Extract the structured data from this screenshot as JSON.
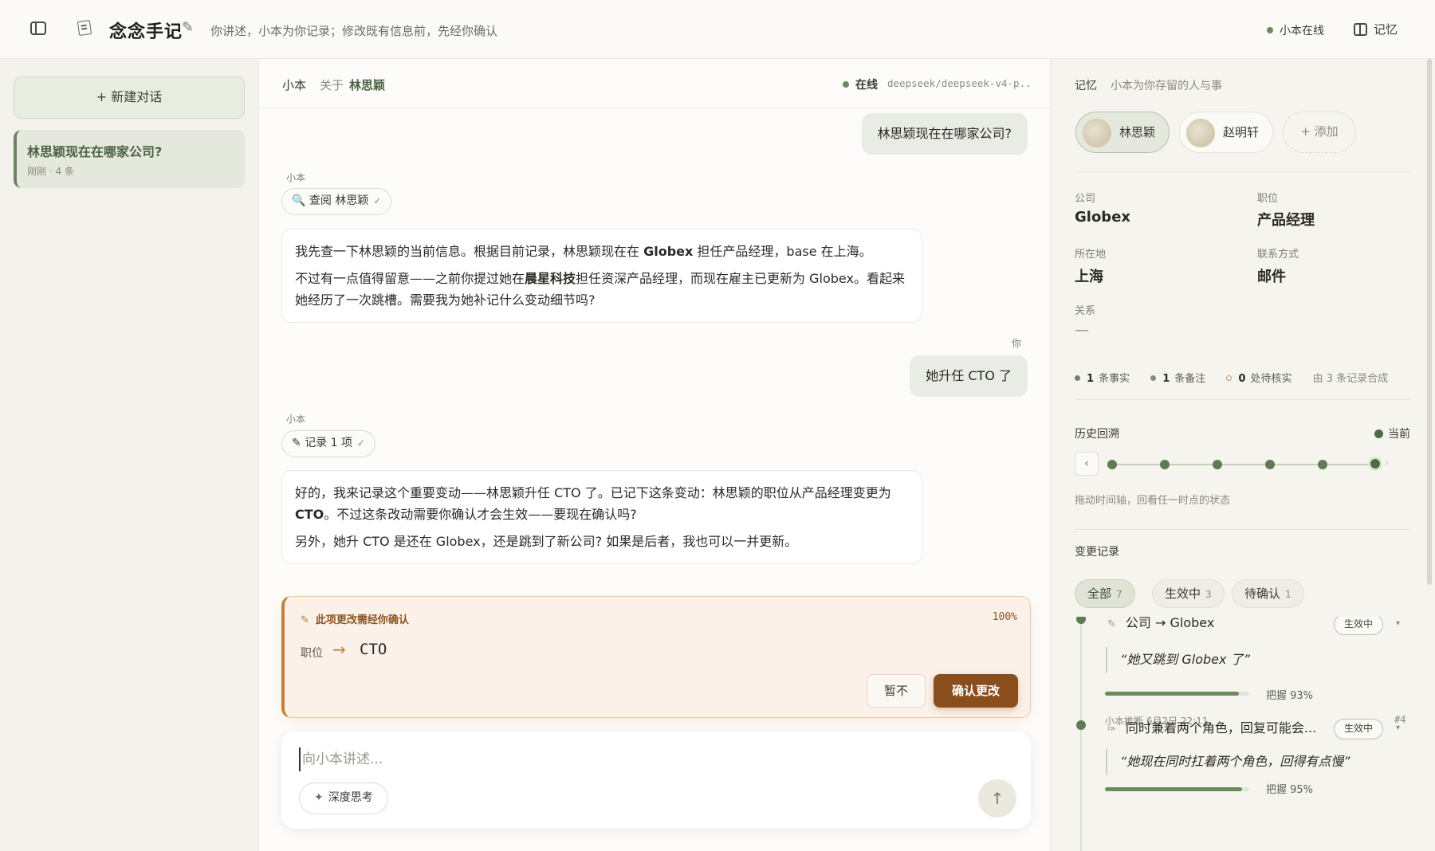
{
  "header": {
    "app_title": "念念手记",
    "title_pen": "✎",
    "subtitle": "你讲述，小本为你记录；修改既有信息前，先经你确认",
    "status": "小本在线",
    "memory_button": "记忆"
  },
  "sidebar": {
    "new_chat": "+ 新建对话",
    "conversations": [
      {
        "title": "林思颖现在在哪家公司?",
        "meta": "刚刚 · 4 条"
      }
    ]
  },
  "chat": {
    "header": {
      "name": "小本",
      "about": "关于",
      "person": "林思颖",
      "status": "在线",
      "model": "deepseek/deepseek-v4-p..."
    },
    "messages": {
      "user1": "林思颖现在在哪家公司?",
      "ai1_speaker": "小本",
      "ai1_tool": "查阅 林思颖",
      "ai1_p1_a": "我先查一下林思颖的当前信息。根据目前记录，林思颖现在在 ",
      "ai1_p1_b": "Globex",
      "ai1_p1_c": " 担任产品经理，base 在上海。",
      "ai1_p2_a": "不过有一点值得留意——之前你提过她在",
      "ai1_p2_b": "晨星科技",
      "ai1_p2_c": "担任资深产品经理，而现在雇主已更新为 Globex。看起来她经历了一次跳槽。需要我为她补记什么变动细节吗?",
      "user2_speaker": "你",
      "user2": "她升任 CTO 了",
      "ai2_speaker": "小本",
      "ai2_tool": "记录 1 项",
      "ai2_p1_a": "好的，我来记录这个重要变动——林思颖升任 CTO 了。已记下这条变动：林思颖的职位从产品经理变更为 ",
      "ai2_p1_b": "CTO",
      "ai2_p1_c": "。不过这条改动需要你确认才会生效——要现在确认吗?",
      "ai2_p2": "另外，她升 CTO 是还在 Globex，还是跳到了新公司? 如果是后者，我也可以一并更新。"
    },
    "confirm": {
      "title": "此项更改需经你确认",
      "percent": "100%",
      "field": "职位",
      "arrow": "→",
      "value": "CTO",
      "later": "暂不",
      "ok": "确认更改"
    },
    "composer": {
      "placeholder": "向小本讲述...",
      "think": "深度思考",
      "send": "↑"
    }
  },
  "memory": {
    "title": "记忆",
    "subtitle": "小本为你存留的人与事",
    "people": [
      "林思颖",
      "赵明轩"
    ],
    "add": "+ 添加",
    "fields": {
      "company_label": "公司",
      "company": "Globex",
      "title_label": "职位",
      "title": "产品经理",
      "location_label": "所在地",
      "location": "上海",
      "contact_label": "联系方式",
      "contact": "邮件",
      "relation_label": "关系",
      "relation": "—"
    },
    "stats": {
      "facts_n": "1",
      "facts": "条事实",
      "notes_n": "1",
      "notes": "条备注",
      "pending_n": "0",
      "pending": "处待核实",
      "synth": "由 3 条记录合成"
    },
    "history": {
      "title": "历史回溯",
      "current": "当前",
      "prev": "‹",
      "next": "›",
      "hint": "拖动时间轴，回看任一时点的状态"
    },
    "changes": {
      "title": "变更记录",
      "filters": [
        {
          "label": "全部",
          "count": "7"
        },
        {
          "label": "生效中",
          "count": "3"
        },
        {
          "label": "待确认",
          "count": "1"
        }
      ],
      "entries": [
        {
          "icon": "✎",
          "field": "公司 → Globex",
          "badge": "生效中",
          "quote": "“她又跳到 Globex 了”",
          "confidence": 0.93,
          "confidence_label": "把握 93%",
          "meta": "小本推断    6月2日 22:11",
          "id": "#4"
        },
        {
          "icon": "✑",
          "field": "同时兼着两个角色，回复可能会...",
          "badge": "生效中",
          "quote": "“她现在同时扛着两个角色，回得有点慢”",
          "confidence": 0.95,
          "confidence_label": "把握 95%"
        }
      ]
    }
  }
}
